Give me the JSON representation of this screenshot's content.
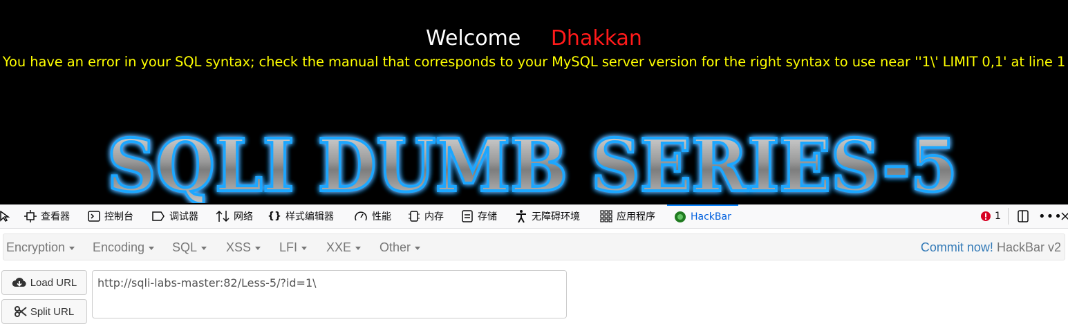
{
  "page": {
    "welcome": "Welcome",
    "name": "Dhakkan",
    "error": "You have an error in your SQL syntax; check the manual that corresponds to your MySQL server version for the right syntax to use near ''1\\' LIMIT 0,1' at line 1",
    "banner_text": "SQLI DUMB SERIES-5"
  },
  "devtools": {
    "tabs": [
      "查看器",
      "控制台",
      "调试器",
      "网络",
      "样式编辑器",
      "性能",
      "内存",
      "存储",
      "无障碍环境",
      "应用程序",
      "HackBar"
    ],
    "error_count": "1"
  },
  "hackbar": {
    "menu": [
      "Encryption",
      "Encoding",
      "SQL",
      "XSS",
      "LFI",
      "XXE",
      "Other"
    ],
    "commit": "Commit now!",
    "title": "HackBar v2",
    "load_url": "Load URL",
    "split_url": "Split URL",
    "url_value": "http://sqli-labs-master:82/Less-5/?id=1\\"
  },
  "colors": {
    "welcome": "#ffffff",
    "name": "#ff1a1a",
    "error": "#ffff00",
    "active_tab": "#0060df",
    "commit_link": "#337ab7"
  }
}
